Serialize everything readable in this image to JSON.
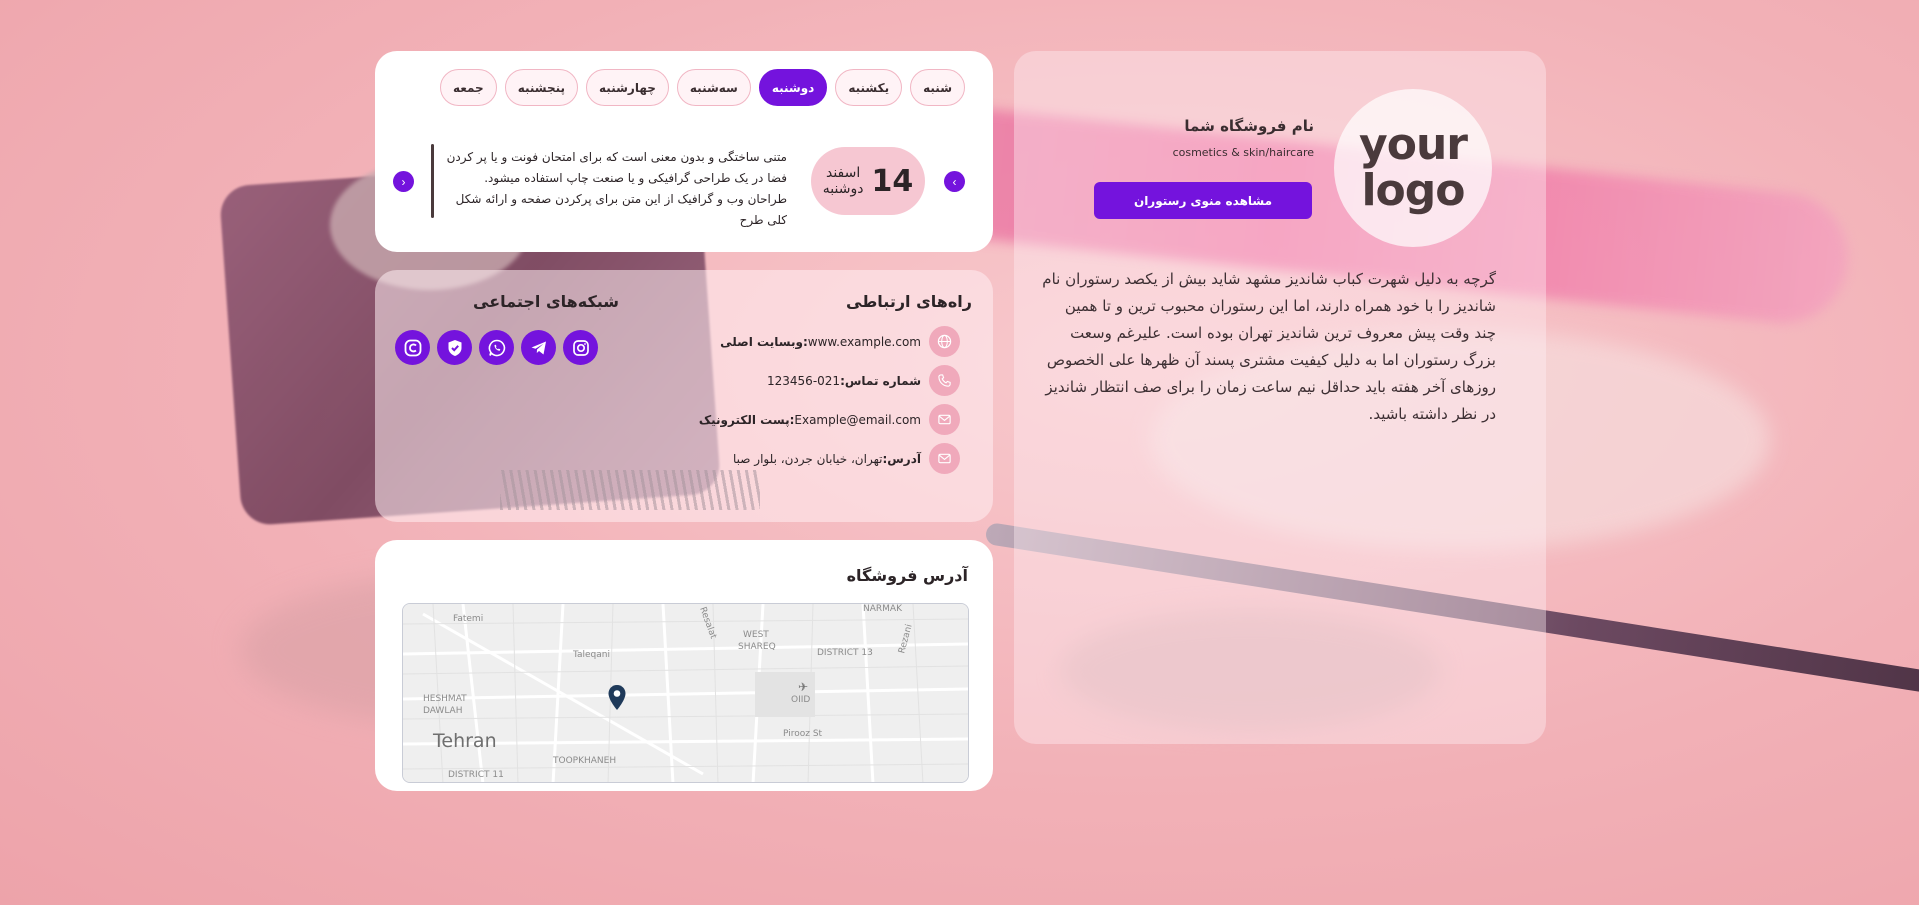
{
  "store": {
    "logo_line1": "your",
    "logo_line2": "logo",
    "name": "نام فروشگاه شما",
    "subtitle": "cosmetics & skin/haircare",
    "menu_button": "مشاهده منوی رستوران",
    "description": "گرچه به دلیل شهرت کباب شاندیز مشهد شاید بیش از یکصد رستوران نام شاندیز را با خود همراه دارند، اما این رستوران محبوب ترین و تا همین چند وقت پیش معروف ترین شاندیز تهران بوده است. علیرغم وسعت بزرگ رستوران اما به دلیل کیفیت مشتری پسند آن ظهرها علی الخصوص روزهای آخر هفته باید حداقل نیم ساعت زمان را برای صف انتظار شاندیز در نظر داشته باشید."
  },
  "schedule": {
    "days": [
      "شنبه",
      "یکشنبه",
      "دوشنبه",
      "سه‌شنبه",
      "چهارشنبه",
      "پنجشنبه",
      "جمعه"
    ],
    "active_day": "دوشنبه",
    "date_number": "14",
    "date_month": "اسفند",
    "date_weekday": "دوشنبه",
    "note": "متنی ساختگی و بدون معنی است که برای امتحان فونت و یا پر کردن فضا در یک طراحی گرافیکی و یا صنعت چاپ استفاده میشود. طراحان وب و گرافیک از این متن برای پرکردن صفحه و ارائه شکل کلی طرح"
  },
  "contact": {
    "title": "راه‌های ارتباطی",
    "rows": [
      {
        "label": "وبسایت اصلی:",
        "value": "www.example.com",
        "icon": "globe-icon"
      },
      {
        "label": "شماره تماس:",
        "value": "021-123456",
        "icon": "phone-icon"
      },
      {
        "label": "پست الکترونیک:",
        "value": "Example@email.com",
        "icon": "mail-icon"
      },
      {
        "label": "آدرس:",
        "value": "تهران، خیابان جردن، بلوار صبا",
        "icon": "mail-icon"
      }
    ]
  },
  "social": {
    "title": "شبکه‌های اجتماعی",
    "icons": [
      "eitaa-icon",
      "check-shield-icon",
      "whatsapp-icon",
      "telegram-icon",
      "instagram-icon"
    ]
  },
  "map_section": {
    "title": "آدرس فروشگاه",
    "labels": {
      "city": "Tehran",
      "fatemi": "Fatemi",
      "taleqani": "Taleqani",
      "heshmat": "HESHMAT",
      "dawlah": "DAWLAH",
      "west": "WEST",
      "shareq": "SHAREQ",
      "district13": "DISTRICT 13",
      "district11": "DISTRICT 11",
      "narmak": "NARMAK",
      "resalat": "Resalat",
      "rezani": "Rezani",
      "oiid": "OIID",
      "pirooz": "Pirooz St",
      "toopkhaneh": "TOOPKHANEH"
    }
  },
  "colors": {
    "accent": "#7413dd",
    "pink_soft": "#f6c7d2",
    "icon_pink": "#f0a9bb"
  }
}
